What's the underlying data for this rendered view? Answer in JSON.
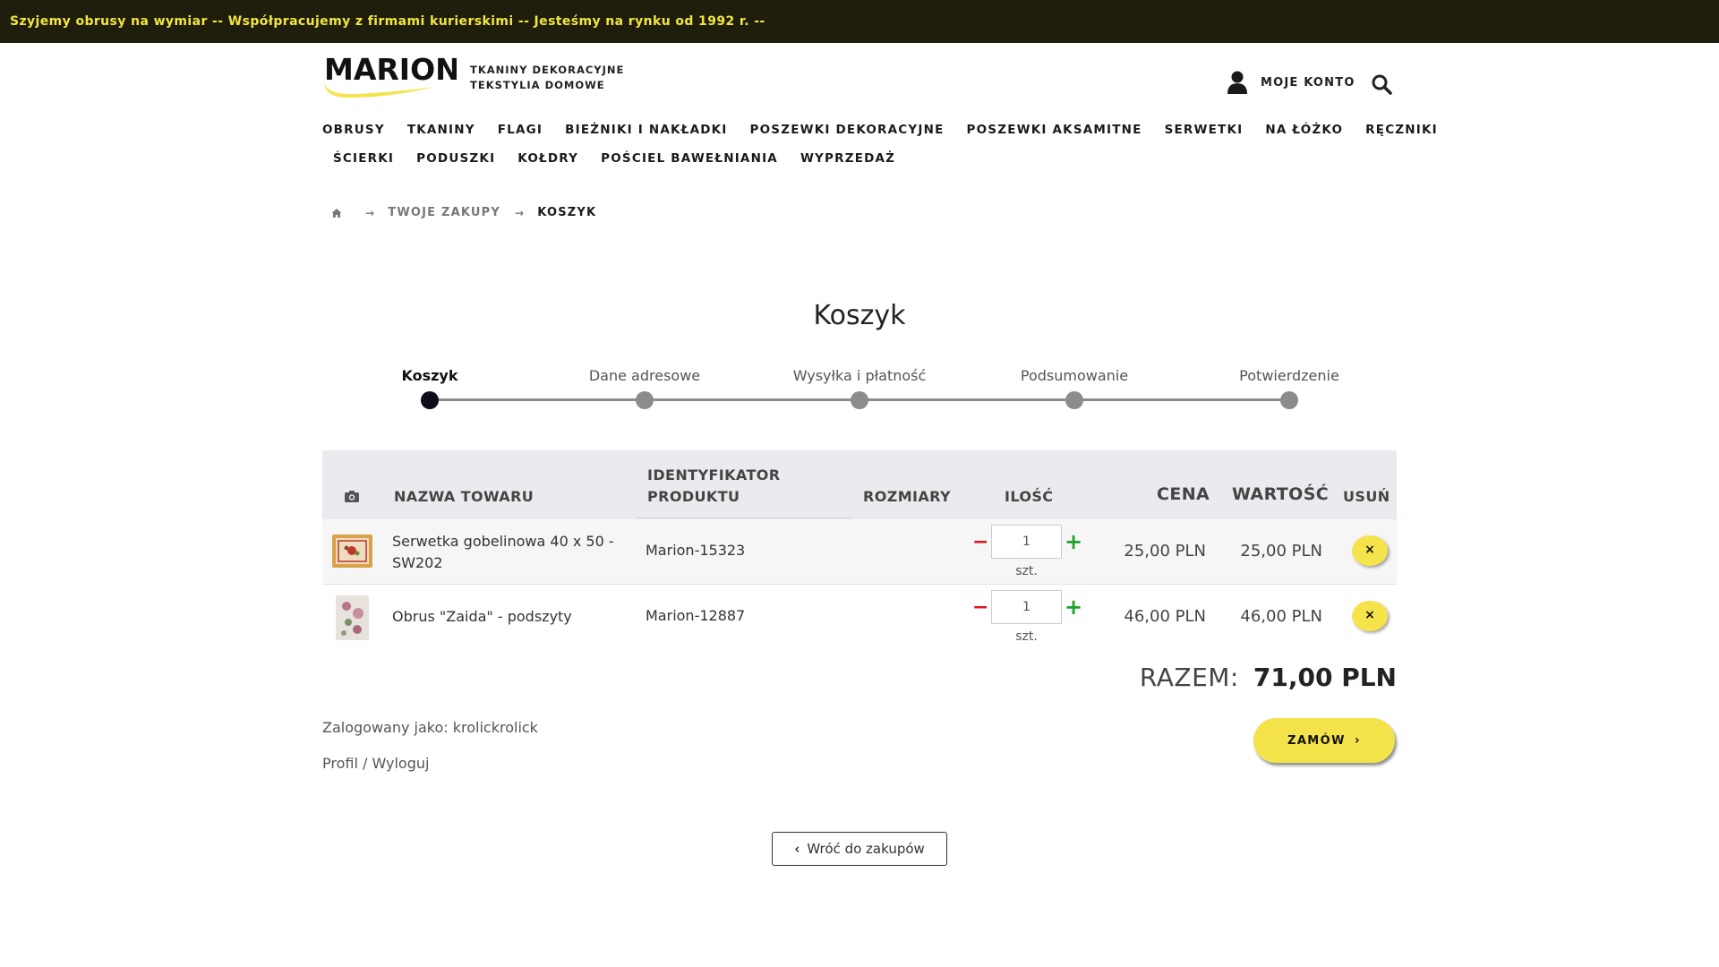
{
  "topbar": {
    "text": "Szyjemy obrusy na wymiar  --  Współpracujemy z firmami kurierskimi  --  Jesteśmy na rynku od 1992 r. --"
  },
  "header": {
    "logo_text": "MARION",
    "tagline_line1": "TKANINY DEKORACYJNE",
    "tagline_line2": "TEKSTYLIA DOMOWE",
    "account_label": "MOJE KONTO",
    "brand_color": "#f4e34a"
  },
  "nav": {
    "row1": [
      "OBRUSY",
      "TKANINY",
      "FLAGI",
      "BIEŻNIKI I NAKŁADKI",
      "POSZEWKI DEKORACYJNE",
      "POSZEWKI AKSAMITNE",
      "SERWETKI",
      "NA ŁÓŻKO",
      "RĘCZNIKI"
    ],
    "row2": [
      "ŚCIERKI",
      "PODUSZKI",
      "KOŁDRY",
      "POŚCIEL BAWEŁNIANIA",
      "WYPRZEDAŻ"
    ]
  },
  "breadcrumb": {
    "link": "TWOJE ZAKUPY",
    "current": "KOSZYK"
  },
  "page_title": "Koszyk",
  "steps": [
    {
      "label": "Koszyk",
      "active": true
    },
    {
      "label": "Dane adresowe",
      "active": false
    },
    {
      "label": "Wysyłka i płatność",
      "active": false
    },
    {
      "label": "Podsumowanie",
      "active": false
    },
    {
      "label": "Potwierdzenie",
      "active": false
    }
  ],
  "table": {
    "headers": {
      "name": "NAZWA TOWARU",
      "id_line1": "IDENTYFIKATOR",
      "id_line2": "PRODUKTU",
      "sizes": "ROZMIARY",
      "qty": "ILOŚĆ",
      "price": "CENA",
      "value": "WARTOŚĆ",
      "remove": "USUŃ"
    },
    "rows": [
      {
        "name": "Serwetka gobelinowa 40 x 50 - SW202",
        "product_id": "Marion-15323",
        "sizes": "",
        "qty": "1",
        "unit": "szt.",
        "price": "25,00 PLN",
        "value": "25,00 PLN",
        "remove_symbol": "×"
      },
      {
        "name": "Obrus \"Zaida\" - podszyty",
        "product_id": "Marion-12887",
        "sizes": "",
        "qty": "1",
        "unit": "szt.",
        "price": "46,00 PLN",
        "value": "46,00 PLN",
        "remove_symbol": "×"
      }
    ]
  },
  "total": {
    "label": "RAZEM:",
    "value": "71,00 PLN"
  },
  "user": {
    "logged_in_as": "Zalogowany jako: krolickrolick",
    "profile_link": "Profil",
    "separator": " / ",
    "logout_link": "Wyloguj"
  },
  "buttons": {
    "order": "ZAMÓW",
    "back": "Wróć do zakupów"
  },
  "icons": {
    "user": "user-icon",
    "search": "search-icon",
    "home": "home-icon",
    "camera": "camera-icon"
  }
}
